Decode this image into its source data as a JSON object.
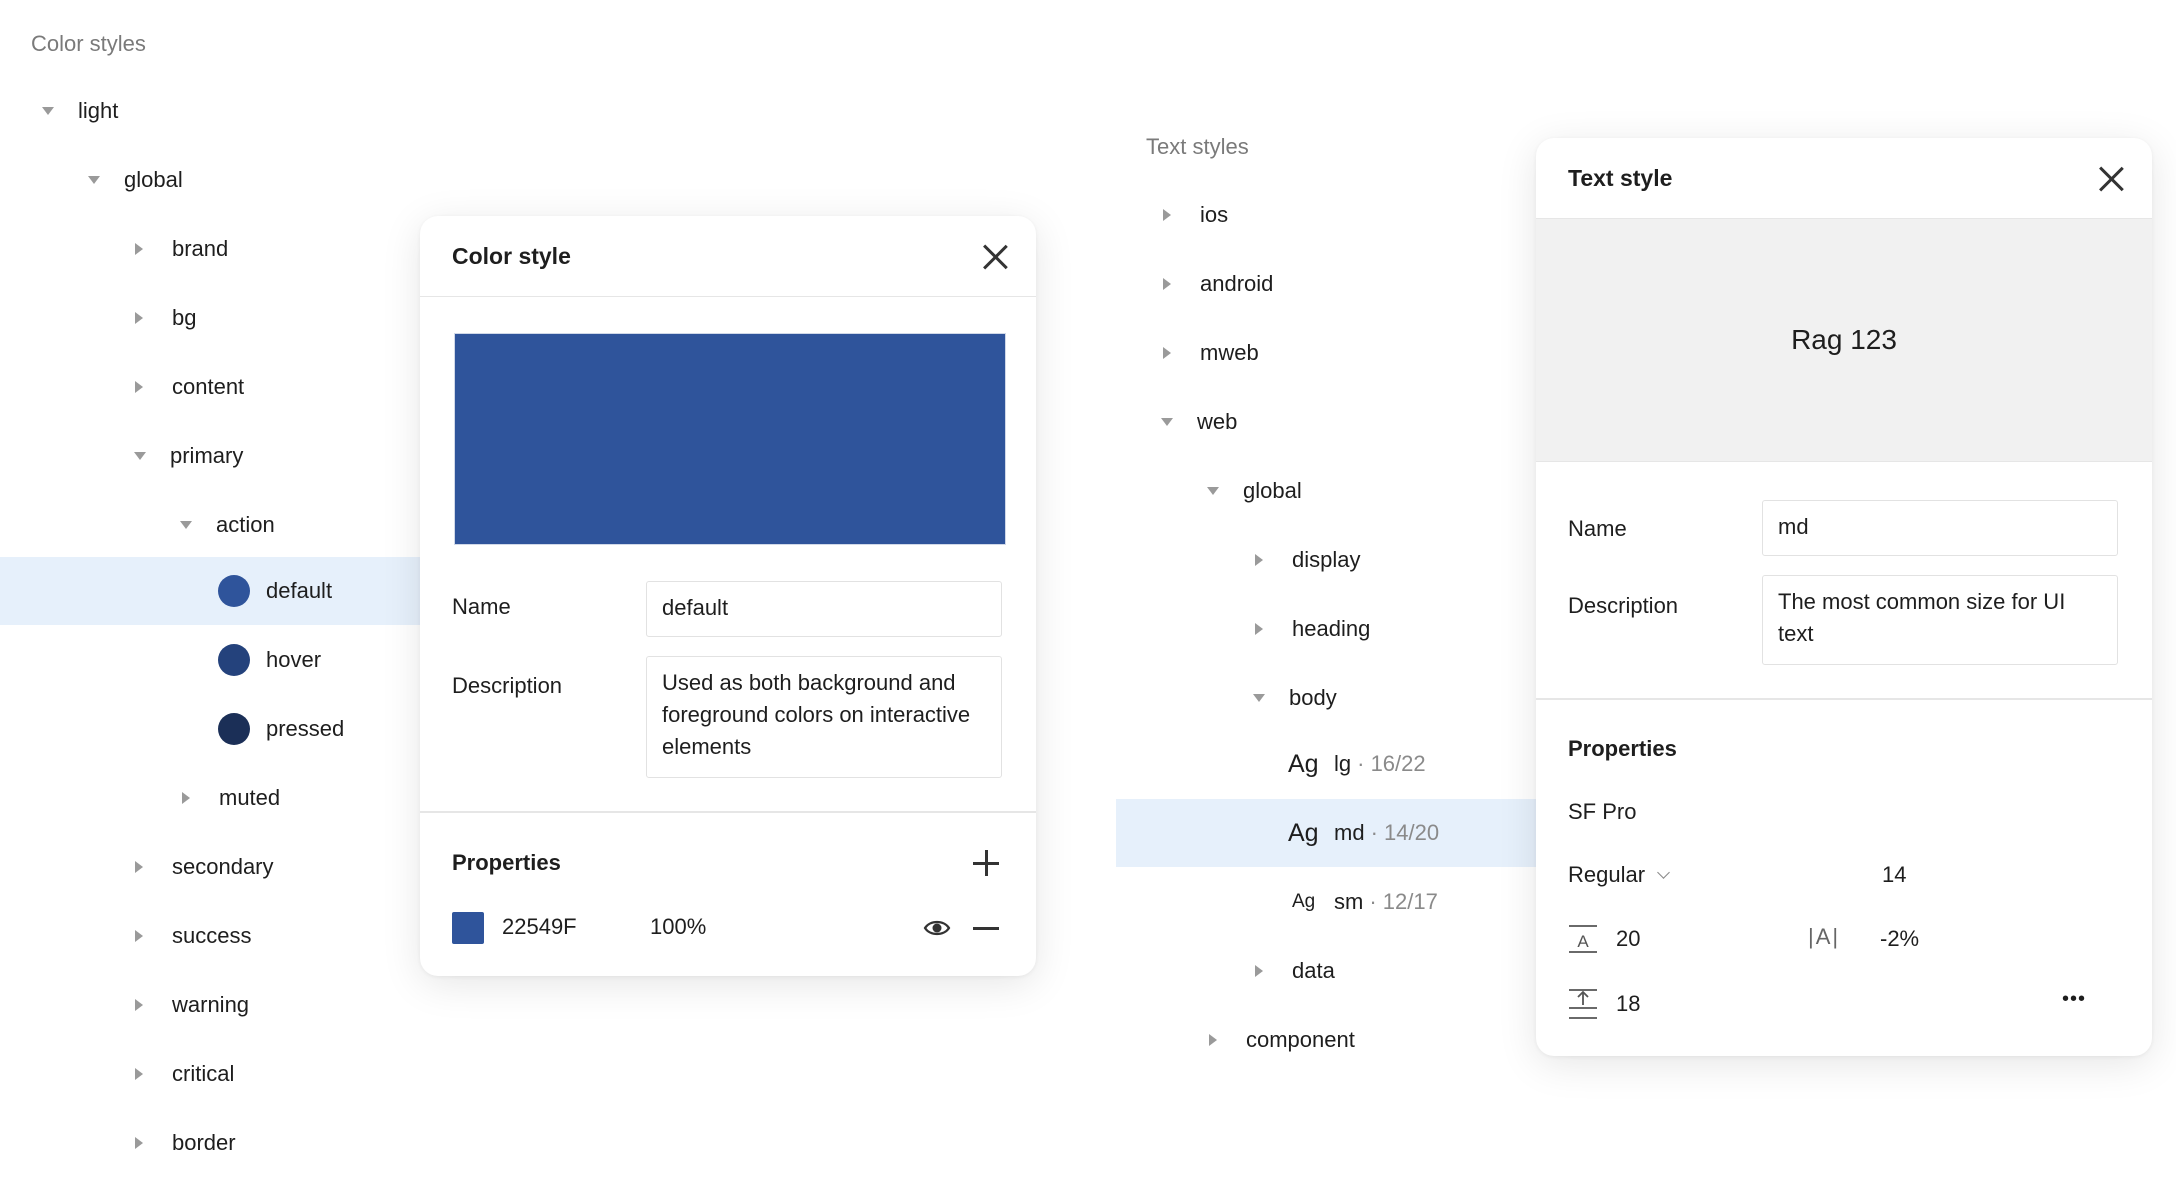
{
  "color_styles": {
    "title": "Color styles",
    "tree": [
      {
        "label": "light",
        "expanded": true
      },
      {
        "label": "global",
        "expanded": true
      },
      {
        "label": "brand",
        "expanded": false
      },
      {
        "label": "bg",
        "expanded": false
      },
      {
        "label": "content",
        "expanded": false
      },
      {
        "label": "primary",
        "expanded": true
      },
      {
        "label": "action",
        "expanded": true
      },
      {
        "label": "default",
        "color": "#2F549B",
        "selected": true
      },
      {
        "label": "hover",
        "color": "#24427C"
      },
      {
        "label": "pressed",
        "color": "#1B2F57"
      },
      {
        "label": "muted",
        "expanded": false
      },
      {
        "label": "secondary",
        "expanded": false
      },
      {
        "label": "success",
        "expanded": false
      },
      {
        "label": "warning",
        "expanded": false
      },
      {
        "label": "critical",
        "expanded": false
      },
      {
        "label": "border",
        "expanded": false
      }
    ]
  },
  "color_panel": {
    "title": "Color style",
    "preview_color": "#2F549B",
    "name_label": "Name",
    "name_value": "default",
    "description_label": "Description",
    "description_value": "Used as both background and foreground colors on interactive elements",
    "properties_label": "Properties",
    "fill_hex": "22549F",
    "fill_opacity": "100%",
    "fill_swatch": "#2F549B"
  },
  "text_styles": {
    "title": "Text styles",
    "tree": [
      {
        "label": "ios",
        "expanded": false
      },
      {
        "label": "android",
        "expanded": false
      },
      {
        "label": "mweb",
        "expanded": false
      },
      {
        "label": "web",
        "expanded": true
      },
      {
        "label": "global",
        "expanded": true
      },
      {
        "label": "display",
        "expanded": false
      },
      {
        "label": "heading",
        "expanded": false
      },
      {
        "label": "body",
        "expanded": true
      },
      {
        "sample": "Ag",
        "label": "lg",
        "meta": "· 16/22"
      },
      {
        "sample": "Ag",
        "label": "md",
        "meta": "· 14/20",
        "selected": true
      },
      {
        "sample": "Ag",
        "label": "sm",
        "meta": "· 12/17"
      },
      {
        "label": "data",
        "expanded": false
      },
      {
        "label": "component",
        "expanded": false
      }
    ]
  },
  "text_panel": {
    "title": "Text style",
    "preview_text": "Rag 123",
    "name_label": "Name",
    "name_value": "md",
    "description_label": "Description",
    "description_value": "The most common size for UI text",
    "properties_label": "Properties",
    "font_family": "SF Pro",
    "font_weight": "Regular",
    "font_size": "14",
    "line_height": "20",
    "letter_spacing_icon": "|A|",
    "letter_spacing": "-2%",
    "paragraph_spacing": "18",
    "more": "•••"
  },
  "colors": {
    "selection": "#E6F0FB",
    "accent": "#2F549B"
  }
}
